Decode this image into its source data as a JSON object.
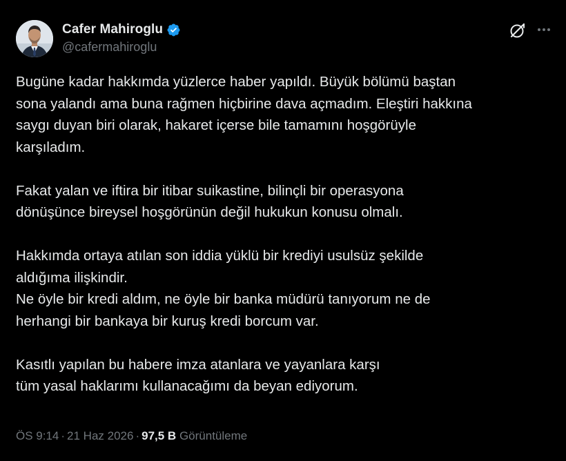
{
  "author": {
    "display_name": "Cafer Mahiroglu",
    "handle": "@cafermahiroglu",
    "verified_color": "#1d9bf0",
    "avatar_icon": "profile-photo"
  },
  "actions": {
    "grok_icon": "grok-icon",
    "more_icon": "more-horizontal-icon"
  },
  "tweet": {
    "paragraphs": [
      {
        "lines": [
          "Bugüne kadar hakkımda yüzlerce haber yapıldı. Büyük bölümü baştan",
          "sona yalandı ama buna rağmen hiçbirine dava açmadım. Eleştiri hakkına",
          "saygı duyan biri olarak, hakaret içerse bile tamamını hoşgörüyle",
          "karşıladım."
        ]
      },
      {
        "lines": [
          "Fakat yalan ve iftira bir itibar suikastine, bilinçli bir operasyona",
          "dönüşünce bireysel hoşgörünün değil hukukun konusu olmalı."
        ]
      },
      {
        "lines": [
          "Hakkımda ortaya atılan son iddia yüklü bir krediyi usulsüz şekilde",
          "aldığıma ilişkindir.",
          "Ne öyle bir kredi aldım, ne öyle bir banka müdürü tanıyorum ne de",
          "herhangi bir bankaya bir kuruş kredi borcum var."
        ]
      },
      {
        "lines": [
          "Kasıtlı yapılan bu habere imza atanlara ve yayanlara karşı",
          "tüm yasal haklarımı kullanacağımı da beyan ediyorum."
        ]
      }
    ]
  },
  "meta": {
    "time": "ÖS 9:14",
    "date": "21 Haz 2026",
    "views_count": "97,5 B",
    "views_label": "Görüntüleme",
    "separator": "·"
  }
}
